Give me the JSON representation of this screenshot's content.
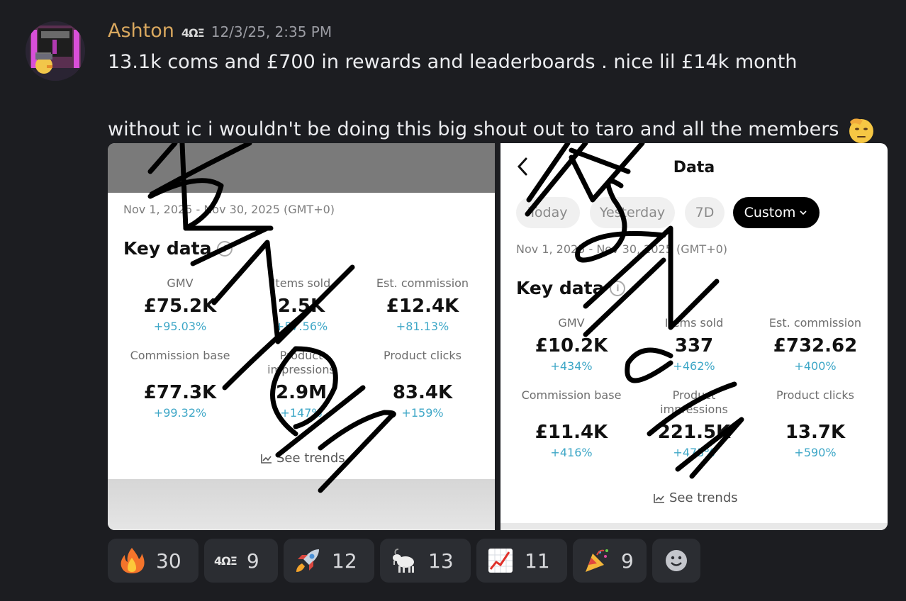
{
  "message": {
    "username": "Ashton",
    "user_tag": "4ΩΞ",
    "timestamp": "12/3/25, 2:35 PM",
    "line1": "13.1k coms and £700 in rewards and leaderboards . nice lil £14k month",
    "line2": "without ic i wouldn't be doing this big shout out to taro and all the members"
  },
  "left_shot": {
    "date_range": "Nov 1, 2025 - Nov 30, 2025 (GMT+0)",
    "key_data_title": "Key data",
    "metrics": [
      {
        "label": "GMV",
        "value": "£75.2K",
        "delta": "+95.03%"
      },
      {
        "label": "Items sold",
        "value": "2.5K",
        "delta": "+57.56%"
      },
      {
        "label": "Est. commission",
        "value": "£12.4K",
        "delta": "+81.13%"
      },
      {
        "label": "Commission base",
        "value": "£77.3K",
        "delta": "+99.32%"
      },
      {
        "label": "Product impressions",
        "value": "2.9M",
        "delta": "+147%"
      },
      {
        "label": "Product clicks",
        "value": "83.4K",
        "delta": "+159%"
      }
    ],
    "see_trends": "See trends"
  },
  "right_shot": {
    "title": "Data",
    "chips": [
      "Today",
      "Yesterday",
      "7D",
      "Custom"
    ],
    "active_chip": "Custom",
    "date_range": "Nov 1, 2025 - Nov 30, 2025 (GMT+0)",
    "key_data_title": "Key data",
    "metrics": [
      {
        "label": "GMV",
        "value": "£10.2K",
        "delta": "+434%"
      },
      {
        "label": "Items sold",
        "value": "337",
        "delta": "+462%"
      },
      {
        "label": "Est. commission",
        "value": "£732.62",
        "delta": "+400%"
      },
      {
        "label": "Commission base",
        "value": "£11.4K",
        "delta": "+416%"
      },
      {
        "label": "Product impressions",
        "value": "221.5K",
        "delta": "+473%"
      },
      {
        "label": "Product clicks",
        "value": "13.7K",
        "delta": "+590%"
      }
    ],
    "see_trends": "See trends"
  },
  "reactions": [
    {
      "emoji": "fire",
      "count": "30"
    },
    {
      "emoji": "4ΩΞ",
      "count": "9"
    },
    {
      "emoji": "rocket",
      "count": "12"
    },
    {
      "emoji": "goat",
      "count": "13"
    },
    {
      "emoji": "chart-increasing",
      "count": "11"
    },
    {
      "emoji": "party-popper",
      "count": "9"
    }
  ]
}
